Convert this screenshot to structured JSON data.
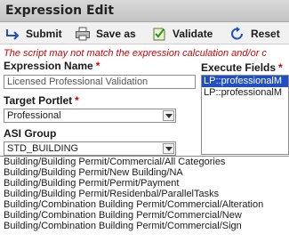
{
  "window": {
    "title": "Expression Edit"
  },
  "toolbar": {
    "submit": {
      "label": "Submit",
      "icon": "arrow-return-icon"
    },
    "save_as": {
      "label": "Save as",
      "icon": "printer-icon"
    },
    "validate": {
      "label": "Validate",
      "icon": "checkbox-page-icon"
    },
    "reset": {
      "label": "Reset",
      "icon": "refresh-icon"
    }
  },
  "warning": "The script may not match the expression calculation and/or c",
  "form": {
    "expression_name": {
      "label": "Expression Name",
      "required": "*",
      "value": "Licensed Professional Validation"
    },
    "target_portlet": {
      "label": "Target Portlet",
      "required": "*",
      "value": "Professional"
    },
    "asi_group": {
      "label": "ASI Group",
      "value": "STD_BUILDING"
    },
    "execute_fields": {
      "label": "Execute Fields",
      "required": "*",
      "items": [
        "LP::professionalM",
        "LP::professionalM"
      ],
      "selected_index": 0
    }
  },
  "asi_dropdown_options": [
    "Building/Building Permit/Commercial/All Categories",
    "Building/Building Permit/New Building/NA",
    "Building/Building Permit/Permit/Payment",
    "Building/Building Permit/Residenbal/ParallelTasks",
    "Building/Combination Building Permit/Commercial/Alteration",
    "Building/Combination Building Permit/Commercial/New",
    "Building/Combination Building Permit/Commercial/Sign"
  ],
  "colors": {
    "required": "#d40000",
    "selection": "#1f4fc2",
    "icon_blue": "#1f4fc2"
  }
}
